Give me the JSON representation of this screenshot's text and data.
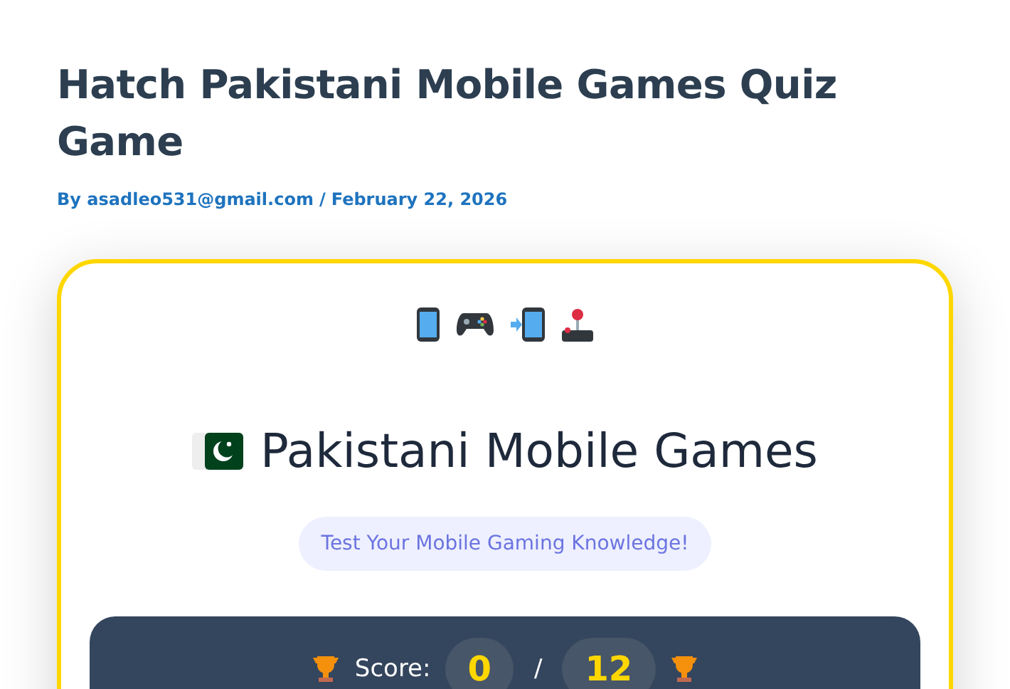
{
  "post": {
    "title": "Hatch Pakistani Mobile Games Quiz Game",
    "author": "By asadleo531@gmail.com",
    "separator": "/",
    "date": "February 22, 2026"
  },
  "quiz": {
    "heading": "Pakistani Mobile Games",
    "subtitle": "Test Your Mobile Gaming Knowledge!",
    "score": {
      "label": "Score:",
      "value": "0",
      "separator": "/",
      "total": "12"
    }
  }
}
